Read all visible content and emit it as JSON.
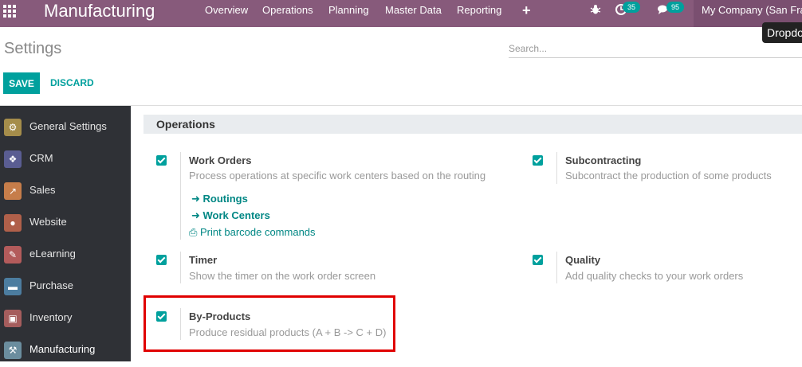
{
  "navbar": {
    "brand": "Manufacturing",
    "menu": [
      "Overview",
      "Operations",
      "Planning",
      "Master Data",
      "Reporting"
    ],
    "plus": "+",
    "activity_count": "35",
    "messages_count": "95",
    "company": "My Company (San Francisco)",
    "tooltip": "Dropdown"
  },
  "control_panel": {
    "title": "Settings",
    "search_placeholder": "Search...",
    "save": "SAVE",
    "discard": "DISCARD"
  },
  "sidebar": {
    "items": [
      {
        "label": "General Settings",
        "icon": "gear-icon",
        "color": "#a58d4b"
      },
      {
        "label": "CRM",
        "icon": "handshake-icon",
        "color": "#5a5d92"
      },
      {
        "label": "Sales",
        "icon": "chart-icon",
        "color": "#c67d4a"
      },
      {
        "label": "Website",
        "icon": "globe-icon",
        "color": "#b0604a"
      },
      {
        "label": "eLearning",
        "icon": "elearning-icon",
        "color": "#b35b5b"
      },
      {
        "label": "Purchase",
        "icon": "credit-card-icon",
        "color": "#4c7da0"
      },
      {
        "label": "Inventory",
        "icon": "box-icon",
        "color": "#a55d5d"
      },
      {
        "label": "Manufacturing",
        "icon": "wrench-icon",
        "color": "#6b8d9e"
      }
    ]
  },
  "section": {
    "title": "Operations",
    "settings": {
      "work_orders": {
        "title": "Work Orders",
        "desc": "Process operations at specific work centers based on the routing",
        "checked": true
      },
      "subcontracting": {
        "title": "Subcontracting",
        "desc": "Subcontract the production of some products",
        "checked": true
      },
      "timer": {
        "title": "Timer",
        "desc": "Show the timer on the work order screen",
        "checked": true
      },
      "quality": {
        "title": "Quality",
        "desc": "Add quality checks to your work orders",
        "checked": true
      },
      "by_products": {
        "title": "By-Products",
        "desc": "Produce residual products (A + B -> C + D)",
        "checked": true
      }
    },
    "links": {
      "routings": "Routings",
      "work_centers": "Work Centers",
      "print_barcode": "Print barcode commands"
    }
  },
  "colors": {
    "navbar": "#875a7b",
    "accent": "#00a09d",
    "sidebar": "#2f3136",
    "highlight": "#e00000"
  }
}
